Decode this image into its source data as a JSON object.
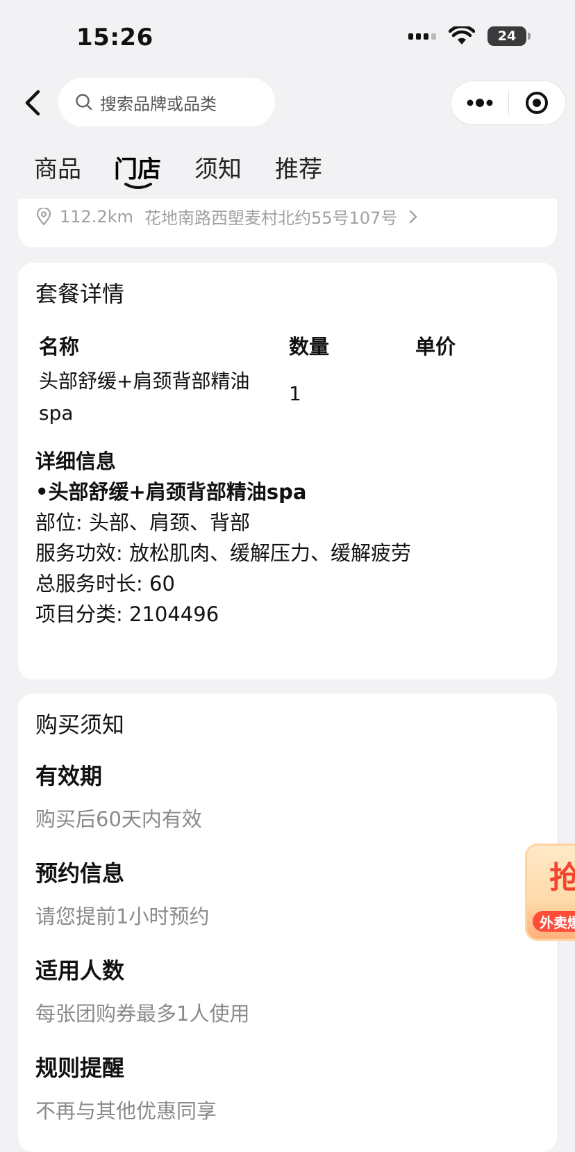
{
  "status_bar": {
    "time": "15:26",
    "battery": "24"
  },
  "nav": {
    "search_placeholder": "搜索品牌或品类"
  },
  "tabs": [
    {
      "label": "商品"
    },
    {
      "label": "门店"
    },
    {
      "label": "须知"
    },
    {
      "label": "推荐"
    }
  ],
  "address": {
    "distance": "112.2km",
    "text": "花地南路西塱麦村北约55号107号"
  },
  "package": {
    "title": "套餐详情",
    "headers": {
      "name": "名称",
      "qty": "数量",
      "price": "单价"
    },
    "row": {
      "name": "头部舒缓+肩颈背部精油spa",
      "qty": "1",
      "price": ""
    },
    "detail_title": "详细信息",
    "detail_item": "•头部舒缓+肩颈背部精油spa",
    "lines": [
      "部位: 头部、肩颈、背部",
      "服务功效: 放松肌肉、缓解压力、缓解疲劳",
      "总服务时长: 60",
      "项目分类: 2104496"
    ]
  },
  "notice": {
    "title": "购买须知",
    "items": [
      {
        "title": "有效期",
        "desc": "购买后60天内有效"
      },
      {
        "title": "预约信息",
        "desc": "请您提前1小时预约"
      },
      {
        "title": "适用人数",
        "desc": "每张团购券最多1人使用"
      },
      {
        "title": "规则提醒",
        "desc": "不再与其他优惠同享"
      }
    ]
  },
  "float_ad": {
    "big": "抢",
    "label": "外卖爆"
  }
}
